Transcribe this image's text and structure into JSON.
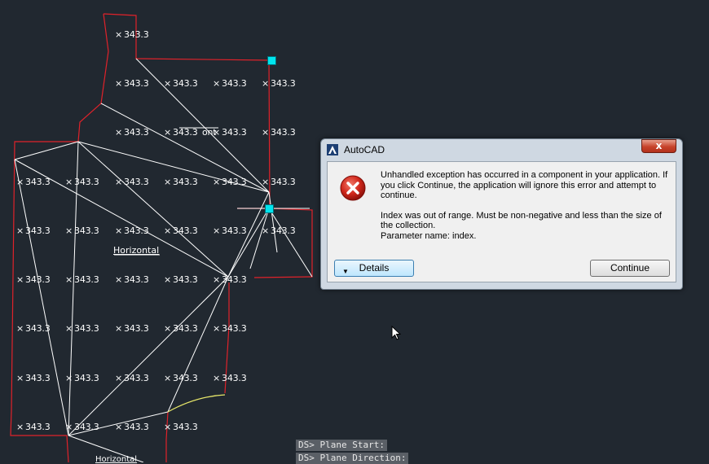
{
  "drawing": {
    "elevation_text": "343.3",
    "overlapped_text": "ont",
    "tin_label": "Horizontal",
    "tin_label_bottom": "Horizontal",
    "colors": {
      "background": "#212830",
      "boundary": "#e0222a",
      "tin_lines": "#ffffff",
      "selected_edge": "#e8e86a",
      "grip": "#00e5ee"
    }
  },
  "dialog": {
    "title": "AutoCAD",
    "app_icon": "autocad-logo-icon",
    "close_label": "x",
    "error_icon": "error-x-icon",
    "message_1": "Unhandled exception has occurred in a component in your application. If you click Continue, the application will ignore this error and attempt to continue.",
    "message_2": "Index was out of range. Must be non-negative and less than the size of the collection.",
    "message_3": "Parameter name: index.",
    "details_label": "Details",
    "continue_label": "Continue"
  },
  "command_line": [
    "DS> Plane Start:",
    "DS> Plane Direction:"
  ]
}
